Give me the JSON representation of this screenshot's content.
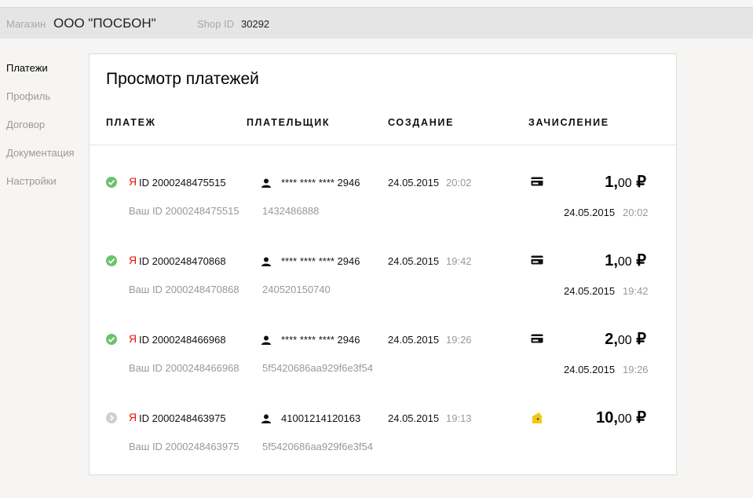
{
  "header": {
    "shop_label": "Магазин",
    "shop_name": "ООО \"ПОСБОН\"",
    "shop_id_label": "Shop ID",
    "shop_id": "30292"
  },
  "sidebar": {
    "items": [
      {
        "label": "Платежи",
        "active": true
      },
      {
        "label": "Профиль"
      },
      {
        "label": "Договор"
      },
      {
        "label": "Документация"
      },
      {
        "label": "Настройки"
      }
    ]
  },
  "main": {
    "title": "Просмотр платежей",
    "columns": {
      "payment": "ПЛАТЕЖ",
      "payer": "ПЛАТЕЛЬЩИК",
      "created": "СОЗДАНИЕ",
      "credited": "ЗАЧИСЛЕНИЕ"
    },
    "rows": [
      {
        "status": "success",
        "ya_mark": "Я",
        "payment_id": "ID 2000248475515",
        "your_id": "Ваш ID 2000248475515",
        "payer": "**** **** **** 2946",
        "payer_sub": "1432486888",
        "created_date": "24.05.2015",
        "created_time": "20:02",
        "method_icon": "card-icon",
        "amount_int": "1,",
        "amount_frac": "00",
        "currency": "₽",
        "credited_date": "24.05.2015",
        "credited_time": "20:02"
      },
      {
        "status": "success",
        "ya_mark": "Я",
        "payment_id": "ID 2000248470868",
        "your_id": "Ваш ID 2000248470868",
        "payer": "**** **** **** 2946",
        "payer_sub": "240520150740",
        "created_date": "24.05.2015",
        "created_time": "19:42",
        "method_icon": "card-icon",
        "amount_int": "1,",
        "amount_frac": "00",
        "currency": "₽",
        "credited_date": "24.05.2015",
        "credited_time": "19:42"
      },
      {
        "status": "success",
        "ya_mark": "Я",
        "payment_id": "ID 2000248466968",
        "your_id": "Ваш ID 2000248466968",
        "payer": "**** **** **** 2946",
        "payer_sub": "5f5420686aa929f6e3f54",
        "created_date": "24.05.2015",
        "created_time": "19:26",
        "method_icon": "card-icon",
        "amount_int": "2,",
        "amount_frac": "00",
        "currency": "₽",
        "credited_date": "24.05.2015",
        "credited_time": "19:26"
      },
      {
        "status": "pending",
        "ya_mark": "Я",
        "payment_id": "ID 2000248463975",
        "your_id": "Ваш ID 2000248463975",
        "payer": "41001214120163",
        "payer_sub": "5f5420686aa929f6e3f54",
        "created_date": "24.05.2015",
        "created_time": "19:13",
        "method_icon": "wallet-icon",
        "amount_int": "10,",
        "amount_frac": "00",
        "currency": "₽",
        "credited_date": "",
        "credited_time": ""
      }
    ]
  },
  "colors": {
    "success": "#6cc26c",
    "pending": "#cfcfcf",
    "yandex_red": "#e61400",
    "wallet_yellow": "#f4c514"
  }
}
